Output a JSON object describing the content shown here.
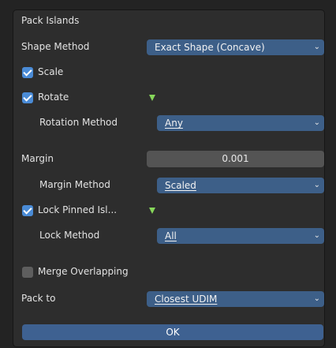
{
  "dialog": {
    "title": "Pack Islands",
    "shape_method": {
      "label": "Shape Method",
      "value": "Exact Shape (Concave)"
    },
    "scale": {
      "label": "Scale",
      "checked": true
    },
    "rotate": {
      "label": "Rotate",
      "checked": true
    },
    "rotation_method": {
      "label": "Rotation Method",
      "value": "Any"
    },
    "margin": {
      "label": "Margin",
      "value": "0.001"
    },
    "margin_method": {
      "label": "Margin Method",
      "value": "Scaled"
    },
    "lock_pinned": {
      "label": "Lock Pinned Isl...",
      "checked": true
    },
    "lock_method": {
      "label": "Lock Method",
      "value": "All"
    },
    "merge_overlapping": {
      "label": "Merge Overlapping",
      "checked": false
    },
    "pack_to": {
      "label": "Pack to",
      "value": "Closest UDIM"
    },
    "ok_label": "OK"
  },
  "icons": {
    "dropdown": "chevron-down-icon",
    "decorator": "keyframe-triangle-icon"
  },
  "colors": {
    "dropdown_bg": "#3d5f88",
    "checkbox_on": "#4a8bd6",
    "decorator": "#86d75a",
    "ok_bg": "#3e6191"
  }
}
